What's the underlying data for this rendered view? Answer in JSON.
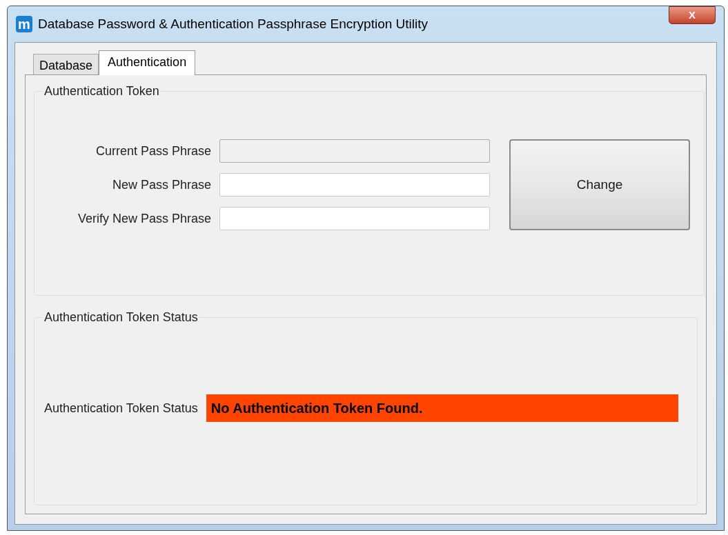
{
  "window": {
    "title": "Database Password & Authentication Passphrase Encryption Utility",
    "app_icon_letter": "m",
    "close_label": "X"
  },
  "tabs": [
    {
      "label": "Database",
      "selected": false
    },
    {
      "label": "Authentication",
      "selected": true
    }
  ],
  "token_group": {
    "title": "Authentication Token",
    "fields": [
      {
        "label": "Current Pass Phrase",
        "disabled": true
      },
      {
        "label": "New Pass Phrase",
        "disabled": false
      },
      {
        "label": "Verify New Pass Phrase",
        "disabled": false
      }
    ],
    "button": "Change"
  },
  "status_group": {
    "title": "Authentication Token Status",
    "label": "Authentication Token Status",
    "status": "No Authentication Token Found.",
    "color": "#ff4500"
  }
}
